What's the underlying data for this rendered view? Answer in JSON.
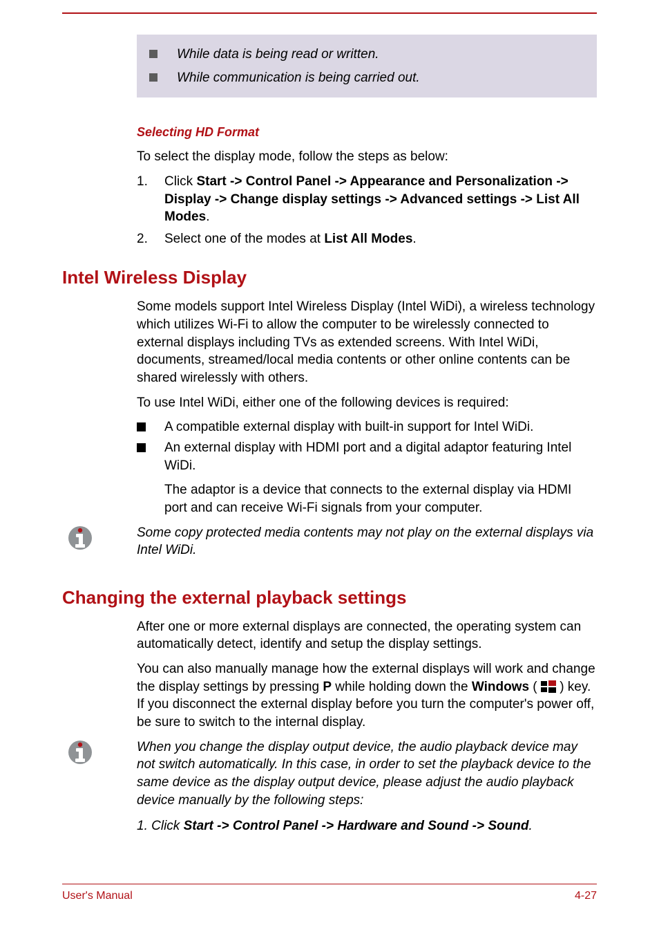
{
  "callout": {
    "items": [
      "While data is being read or written.",
      "While communication is being carried out."
    ]
  },
  "sec_hd_format": {
    "heading": "Selecting HD Format",
    "intro": "To select the display mode, follow the steps as below:",
    "steps": [
      {
        "num": "1.",
        "pre": "Click ",
        "bold": "Start -> Control Panel -> Appearance and Personalization -> Display -> Change display settings -> Advanced settings -> List All Modes",
        "post": "."
      },
      {
        "num": "2.",
        "pre": "Select one of the modes at ",
        "bold": "List All Modes",
        "post": "."
      }
    ]
  },
  "sec_widi": {
    "heading": "Intel Wireless Display",
    "p1": "Some models support Intel Wireless Display (Intel WiDi), a wireless technology which utilizes Wi-Fi to allow the computer to be wirelessly connected to external displays including TVs as extended screens. With Intel WiDi, documents, streamed/local media contents or other online contents can be shared wirelessly with others.",
    "p2": "To use Intel WiDi, either one of the following devices is required:",
    "bullets": [
      "A compatible external display with built-in support for Intel WiDi.",
      "An external display with HDMI port and a digital adaptor featuring Intel WiDi."
    ],
    "bullet2_cont": "The adaptor is a device that connects to the external display via HDMI port and can receive Wi-Fi signals from your computer.",
    "note": "Some copy protected media contents may not play on the external displays via Intel WiDi."
  },
  "sec_playback": {
    "heading": "Changing the external playback settings",
    "p1": "After one or more external displays are connected, the operating system can automatically detect, identify and setup the display settings.",
    "p2a": "You can also manually manage how the external displays will work and change the display settings by pressing ",
    "p2_bold_p": "P",
    "p2b": " while holding down the ",
    "p2_bold_win": "Windows",
    "p2c": " ( ",
    "p2d": " ) key. If you disconnect the external display before you turn the computer's power off, be sure to switch to the internal display.",
    "note_p1": "When you change the display output device, the audio playback device may not switch automatically. In this case, in order to set the playback device to the same device as the display output device, please adjust the audio playback device manually by the following steps:",
    "note_step_pre": "1. Click ",
    "note_step_bold": "Start -> Control Panel -> Hardware and Sound -> Sound",
    "note_step_post": "."
  },
  "footer": {
    "left": "User's Manual",
    "right": "4-27"
  }
}
